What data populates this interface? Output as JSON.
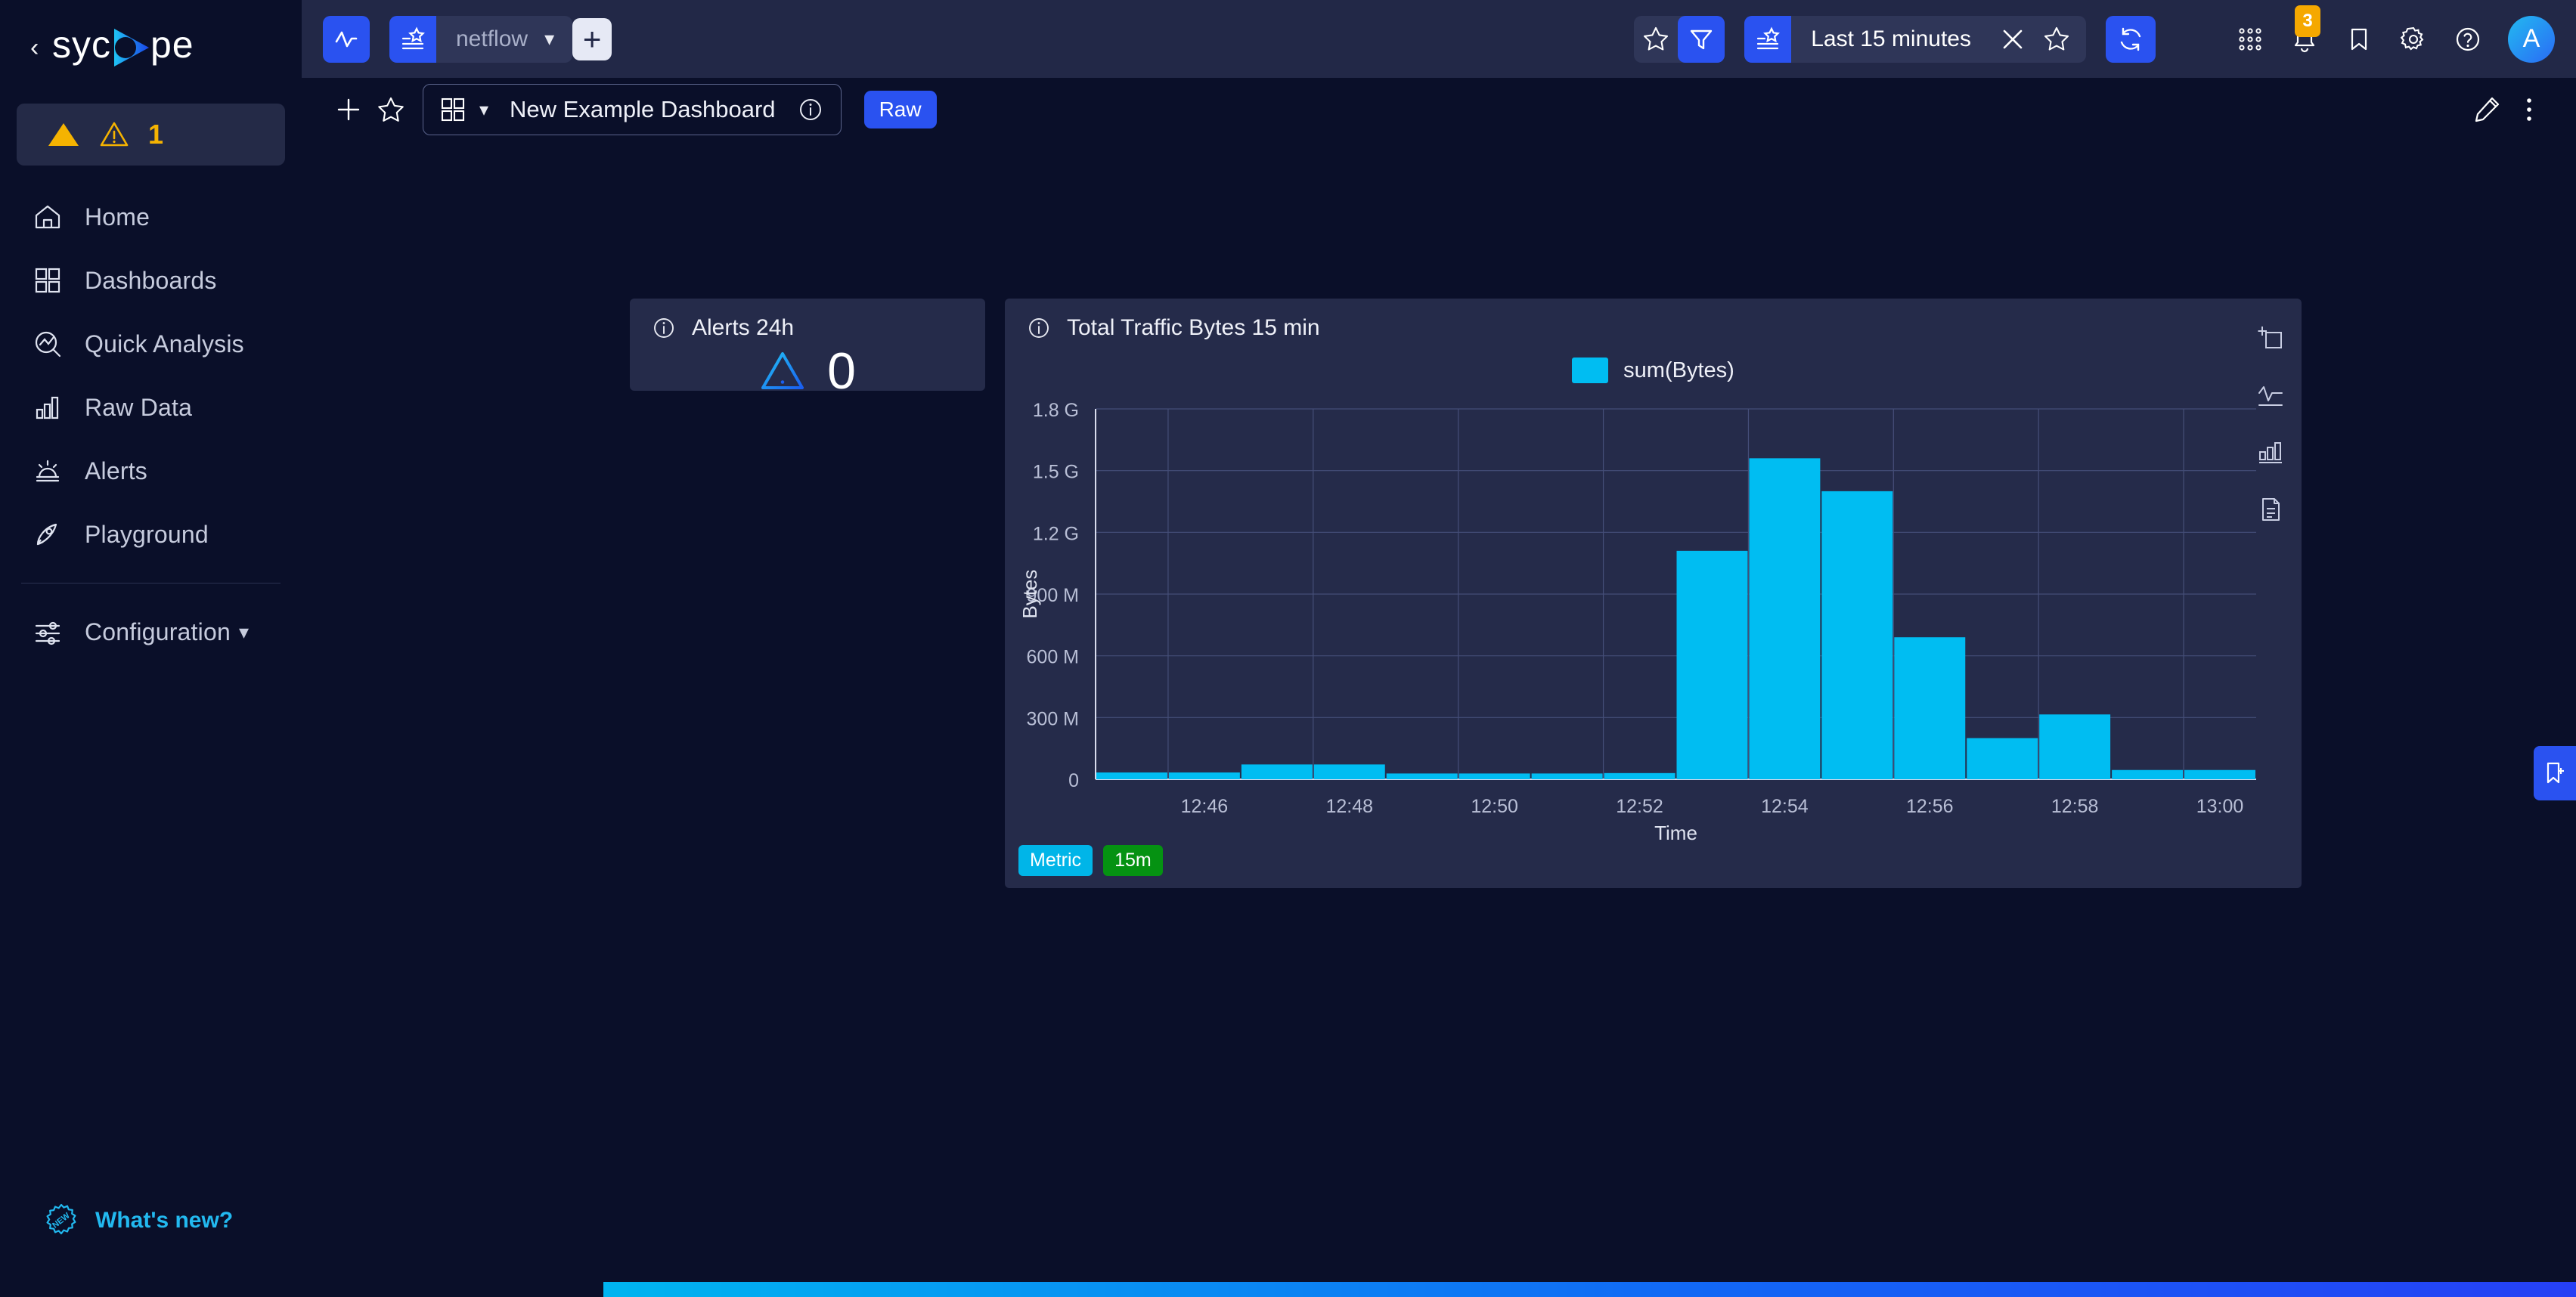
{
  "sidebar": {
    "logo_text": "sycope",
    "collapse_icon": "chevron-left-icon",
    "alert_badge": {
      "icon": "warning-triangle-icon",
      "count": "1"
    },
    "items": [
      {
        "label": "Home",
        "icon": "home-icon"
      },
      {
        "label": "Dashboards",
        "icon": "grid-icon"
      },
      {
        "label": "Quick Analysis",
        "icon": "analysis-magnifier-icon"
      },
      {
        "label": "Raw Data",
        "icon": "bar-chart-icon"
      },
      {
        "label": "Alerts",
        "icon": "siren-icon"
      },
      {
        "label": "Playground",
        "icon": "rocket-icon"
      }
    ],
    "config": {
      "label": "Configuration",
      "icon": "sliders-icon",
      "caret": "chevron-down-icon"
    },
    "whats_new": {
      "label": "What's new?",
      "icon": "new-starburst-icon"
    }
  },
  "topbar": {
    "app_icon": "pulse-icon",
    "datasource": {
      "icon": "saved-list-icon",
      "name": "netflow",
      "caret": "chevron-down-icon"
    },
    "add_label": "+",
    "favorite_icon": "star-icon",
    "filter_icon": "filter-icon",
    "time_range": {
      "icon": "saved-list-icon",
      "label": "Last 15 minutes",
      "clear_icon": "close-x-icon",
      "star_icon": "star-icon"
    },
    "refresh_icon": "refresh-icon",
    "right_icons": [
      {
        "name": "apps-grid-icon"
      },
      {
        "name": "bell-icon",
        "badge": "3"
      },
      {
        "name": "bookmark-icon"
      },
      {
        "name": "gear-icon"
      },
      {
        "name": "help-circle-icon"
      }
    ],
    "avatar_initial": "A"
  },
  "dashbar": {
    "add_icon": "plus-icon",
    "star_icon": "star-icon",
    "grid_icon": "grid-icon",
    "caret_icon": "chevron-down-icon",
    "title": "New Example Dashboard",
    "info_icon": "info-circle-icon",
    "raw_label": "Raw",
    "edit_icon": "pencil-icon",
    "more_icon": "kebab-menu-icon"
  },
  "alerts_panel": {
    "info_icon": "info-circle-icon",
    "title": "Alerts 24h",
    "icon": "warning-triangle-icon",
    "value": "0"
  },
  "chart_panel": {
    "info_icon": "info-circle-icon",
    "title": "Total Traffic Bytes 15 min",
    "tools": [
      {
        "name": "add-panel-icon"
      },
      {
        "name": "line-chart-icon"
      },
      {
        "name": "bar-chart-icon"
      },
      {
        "name": "document-icon"
      }
    ],
    "tags": [
      {
        "label": "Metric",
        "color": "#00b5e8"
      },
      {
        "label": "15m",
        "color": "#059212"
      }
    ]
  },
  "bookmark_tab": {
    "icon": "bookmark-add-icon"
  },
  "colors": {
    "accent_blue": "#2a52f0",
    "accent_cyan": "#00bdf2",
    "warning": "#f5b301",
    "panel_bg": "#252b4a",
    "sidebar_bg": "#0a0f29",
    "bar_fill": "#00bdf2"
  },
  "chart_data": {
    "type": "bar",
    "title": "Total Traffic Bytes 15 min",
    "xlabel": "Time",
    "ylabel": "Bytes",
    "legend": [
      "sum(Bytes)"
    ],
    "legend_position": "top-center",
    "grid": true,
    "ylim": [
      0,
      1800000000
    ],
    "ytick_labels": [
      "0",
      "300 M",
      "600 M",
      "900 M",
      "1.2 G",
      "1.5 G",
      "1.8 G"
    ],
    "ytick_values": [
      0,
      300000000,
      600000000,
      900000000,
      1200000000,
      1500000000,
      1800000000
    ],
    "xtick_labels": [
      "12:46",
      "12:48",
      "12:50",
      "12:52",
      "12:54",
      "12:56",
      "12:58",
      "13:00"
    ],
    "categories": [
      "12:45",
      "12:46",
      "12:47",
      "12:48",
      "12:49",
      "12:50",
      "12:51",
      "12:52",
      "12:53",
      "12:54",
      "12:55",
      "12:56",
      "12:57",
      "12:58",
      "12:59",
      "13:00"
    ],
    "series": [
      {
        "name": "sum(Bytes)",
        "color": "#00bdf2",
        "values": [
          33000000,
          33000000,
          72000000,
          72000000,
          28000000,
          28000000,
          28000000,
          30000000,
          1110000000,
          1560000000,
          1400000000,
          690000000,
          200000000,
          315000000,
          45000000,
          45000000
        ]
      }
    ]
  }
}
